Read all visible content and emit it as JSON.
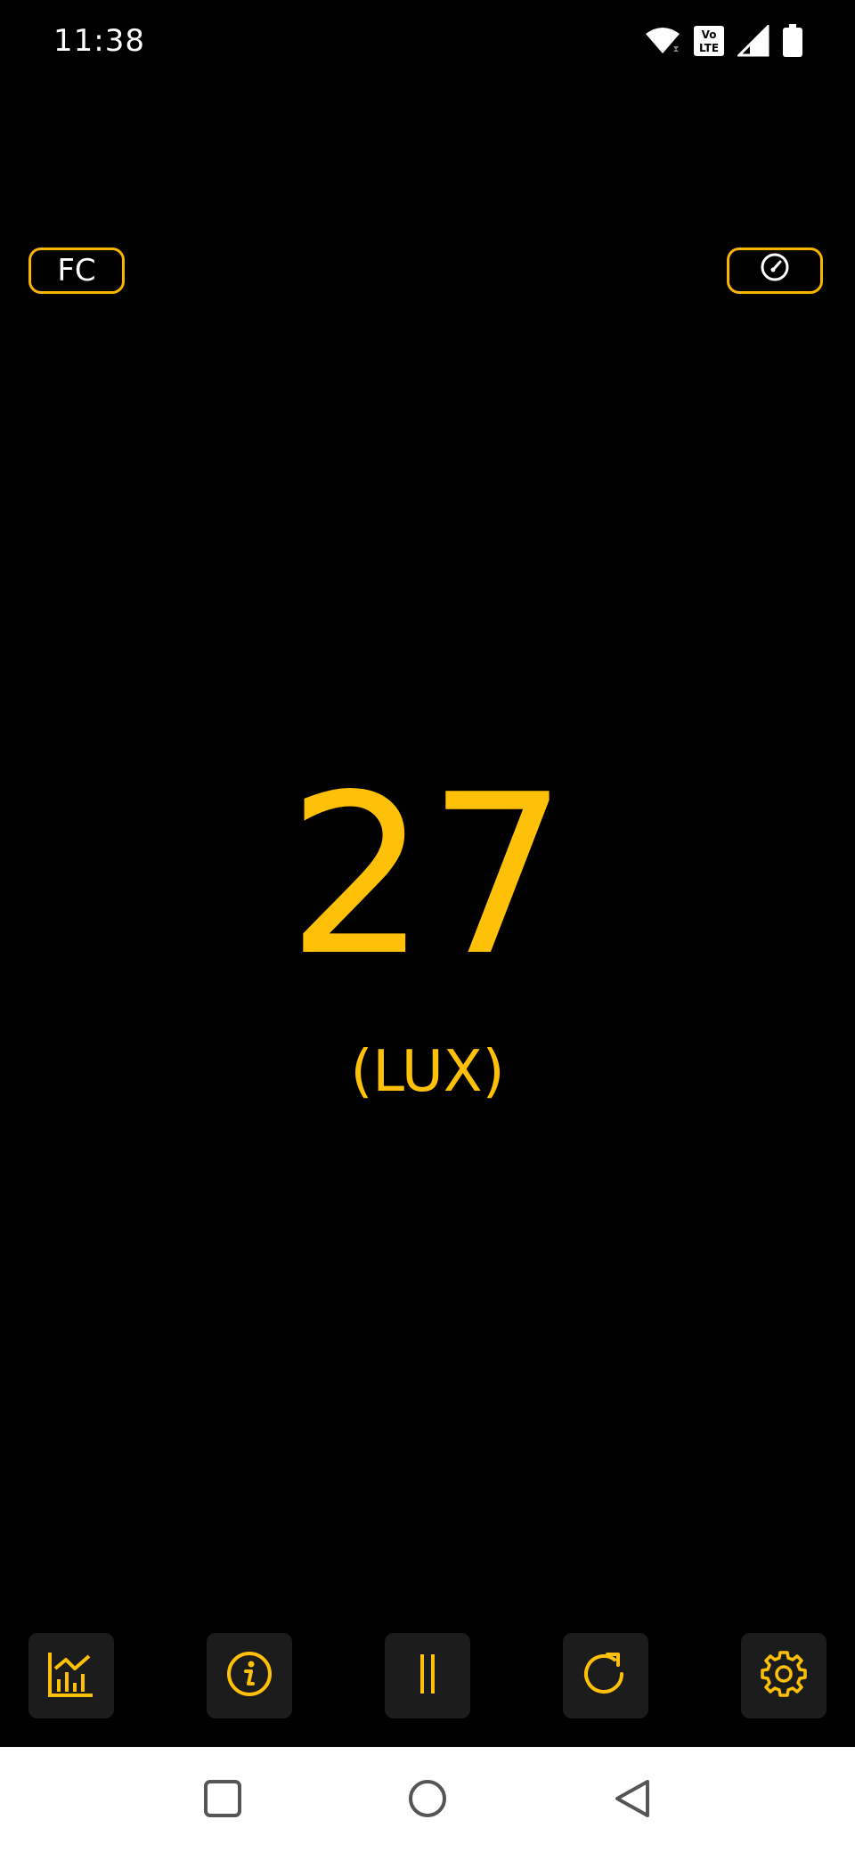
{
  "status_bar": {
    "time": "11:38",
    "icons": [
      "wifi-icon",
      "volte-icon",
      "signal-icon",
      "battery-icon"
    ],
    "volte_text": "Vo LTE"
  },
  "top_buttons": {
    "unit_toggle_label": "FC",
    "meter_icon": "speedometer-icon"
  },
  "reading": {
    "value": "27",
    "unit": "(LUX)"
  },
  "toolbar": {
    "items": [
      "chart-icon",
      "info-icon",
      "pause-icon",
      "refresh-icon",
      "settings-icon"
    ]
  },
  "nav_bar": {
    "items": [
      "recents-square-icon",
      "home-circle-icon",
      "back-triangle-icon"
    ]
  },
  "colors": {
    "background": "#000000",
    "accent": "#ffc107",
    "pill_border": "#f7b500",
    "toolbar_button": "#1c1c1c",
    "nav_bar": "#ffffff",
    "nav_icon": "#555555"
  }
}
